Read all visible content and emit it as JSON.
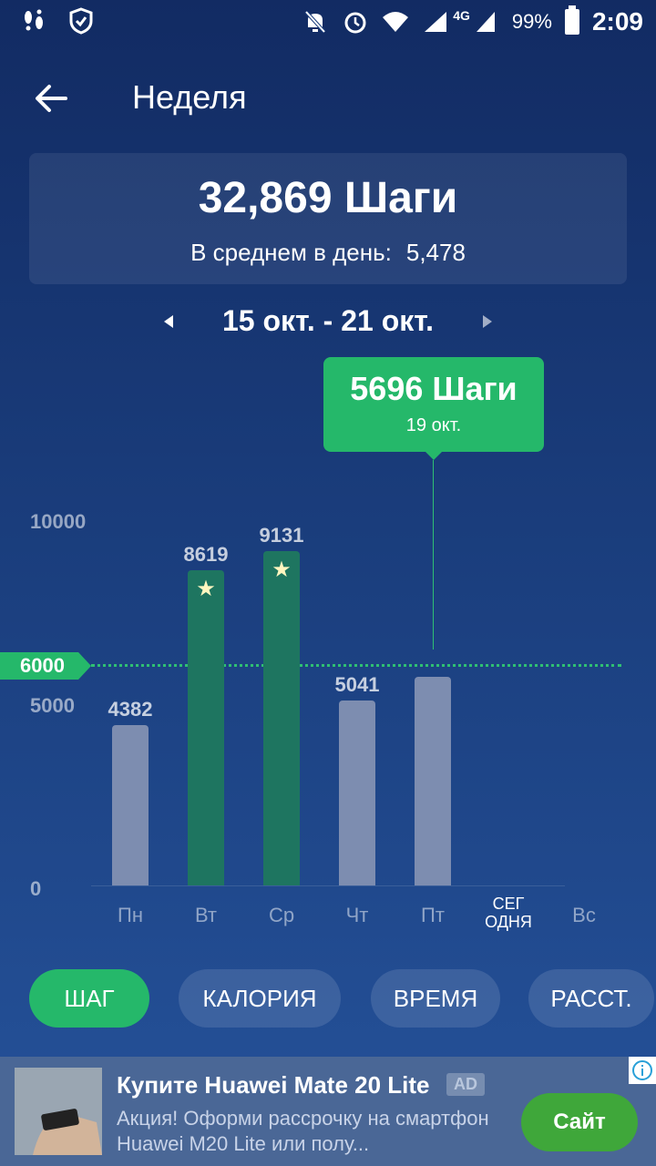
{
  "status_bar": {
    "battery": "99%",
    "time": "2:09",
    "network": "4G",
    "icons": [
      "footsteps-icon",
      "shield-check-icon",
      "bell-off-icon",
      "alarm-icon",
      "wifi-icon",
      "signal-icon",
      "battery-icon"
    ]
  },
  "header": {
    "title": "Неделя",
    "back_icon": "arrow-left-icon"
  },
  "summary": {
    "total": "32,869 Шаги",
    "avg_label": "В среднем в день:",
    "avg_value": "5,478"
  },
  "date_range": {
    "label": "15 окт. - 21 окт."
  },
  "tooltip": {
    "value": "5696 Шаги",
    "date": "19 окт."
  },
  "chart": {
    "goal_label": "6000",
    "y_labels": [
      "10000",
      "5000",
      "0"
    ],
    "days": [
      "Пн",
      "Вт",
      "Ср",
      "Чт",
      "Пт",
      "СЕГ\nОДНЯ",
      "Вс"
    ],
    "bars": [
      {
        "day": "Пн",
        "label": "4382",
        "value": 4382,
        "goal_met": false
      },
      {
        "day": "Вт",
        "label": "8619",
        "value": 8619,
        "goal_met": true
      },
      {
        "day": "Ср",
        "label": "9131",
        "value": 9131,
        "goal_met": true
      },
      {
        "day": "Чт",
        "label": "5041",
        "value": 5041,
        "goal_met": false
      },
      {
        "day": "Пт",
        "label": "",
        "value": 5696,
        "goal_met": false
      }
    ],
    "colors": {
      "goal": "#25b86a",
      "bar_met": "#1e7560",
      "bar_default": "#7d8db0"
    }
  },
  "chart_data": {
    "type": "bar",
    "categories": [
      "Пн",
      "Вт",
      "Ср",
      "Чт",
      "Пт",
      "СЕГОДНЯ",
      "Вс"
    ],
    "values": [
      4382,
      8619,
      9131,
      5041,
      5696,
      0,
      0
    ],
    "title": "",
    "xlabel": "",
    "ylabel": "",
    "ylim": [
      0,
      10000
    ],
    "goal": 6000
  },
  "tabs": [
    {
      "label": "ШАГ",
      "active": true
    },
    {
      "label": "КАЛОРИЯ",
      "active": false
    },
    {
      "label": "ВРЕМЯ",
      "active": false
    },
    {
      "label": "РАССТ.",
      "active": false
    }
  ],
  "ad": {
    "title": "Купите Huawei Mate 20 Lite",
    "badge": "AD",
    "description": "Акция! Оформи рассрочку на смартфон Huawei M20 Lite или полу...",
    "cta": "Сайт",
    "info_icon": "info-icon"
  }
}
